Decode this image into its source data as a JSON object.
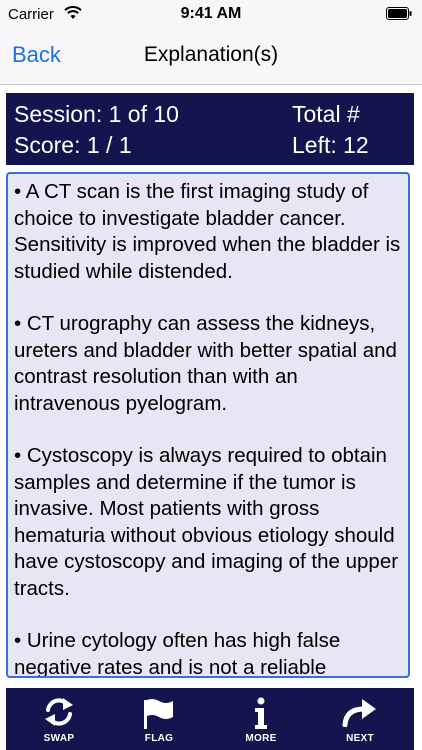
{
  "status_bar": {
    "carrier": "Carrier",
    "time": "9:41 AM",
    "wifi_icon": "wifi-icon",
    "battery_icon": "battery-icon"
  },
  "nav": {
    "back_label": "Back",
    "title": "Explanation(s)"
  },
  "score_panel": {
    "session": "Session: 1 of 10",
    "score": "Score: 1 / 1",
    "total_label": "Total #",
    "left_label": "Left: 12"
  },
  "explanation": {
    "paragraphs": [
      "• A CT scan is the first imaging study of choice to investigate bladder cancer. Sensitivity is improved when the bladder is studied while distended.",
      "•  CT urography can assess the kidneys, ureters and bladder with better spatial and contrast resolution than with an intravenous pyelogram.",
      "•  Cystoscopy is always required to obtain samples and determine if the tumor is invasive. Most patients with gross hematuria without obvious etiology should have cystoscopy and imaging of the upper tracts.",
      "•  Urine cytology often has high false negative rates and is not a reliable"
    ]
  },
  "toolbar": {
    "swap_label": "SWAP",
    "flag_label": "FLAG",
    "more_label": "MORE",
    "next_label": "NEXT"
  },
  "colors": {
    "panel_navy": "#14144e",
    "link_blue": "#1a73d9",
    "text_area_bg": "#e6e6f4",
    "text_area_border": "#3a6fd8"
  }
}
